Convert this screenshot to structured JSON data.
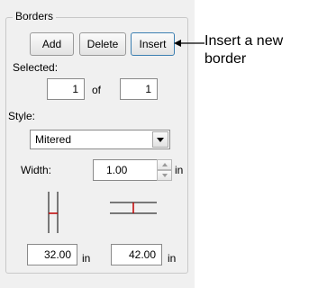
{
  "group": {
    "title": "Borders"
  },
  "buttons": {
    "add": "Add",
    "delete": "Delete",
    "insert": "Insert"
  },
  "selected": {
    "label": "Selected:",
    "current": "1",
    "of_label": "of",
    "total": "1"
  },
  "style": {
    "label": "Style:",
    "value": "Mitered"
  },
  "width": {
    "label": "Width:",
    "value": "1.00",
    "unit": "in"
  },
  "dims": {
    "vertical": "32.00",
    "vertical_unit": "in",
    "horizontal": "42.00",
    "horizontal_unit": "in"
  },
  "callout": {
    "line1": "Insert a new",
    "line2": "border"
  },
  "colors": {
    "marker_red": "#c00000",
    "panel_bg": "#f0f0f0"
  }
}
